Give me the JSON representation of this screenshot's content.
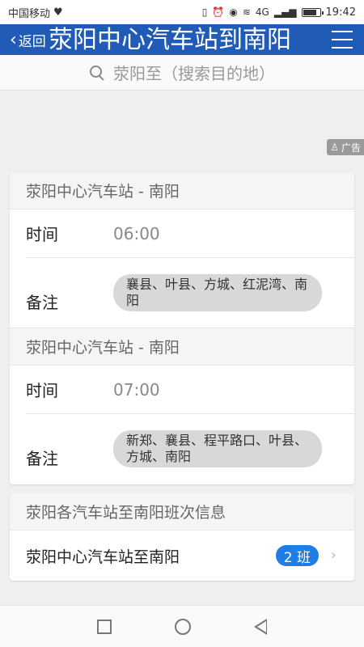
{
  "status_bar": {
    "carrier": "中国移动",
    "net_label": "4G",
    "time": "19:42"
  },
  "header": {
    "back_label": "返回",
    "title": "荥阳中心汽车站到南阳",
    "color": "#1f5bb7"
  },
  "search": {
    "placeholder": "荥阳至（搜索目的地）"
  },
  "ad": {
    "label": "广告"
  },
  "schedules": [
    {
      "route": "荥阳中心汽车站 - 南阳",
      "time_label": "时间",
      "time": "06:00",
      "note_label": "备注",
      "note": "襄县、叶县、方城、红泥湾、南阳"
    },
    {
      "route": "荥阳中心汽车站 - 南阳",
      "time_label": "时间",
      "time": "07:00",
      "note_label": "备注",
      "note": "新郑、襄县、程平路口、叶县、方城、南阳"
    }
  ],
  "summary": {
    "heading": "荥阳各汽车站至南阳班次信息",
    "item_label": "荥阳中心汽车站至南阳",
    "count": "2 班",
    "badge_color": "#1f7de6"
  }
}
